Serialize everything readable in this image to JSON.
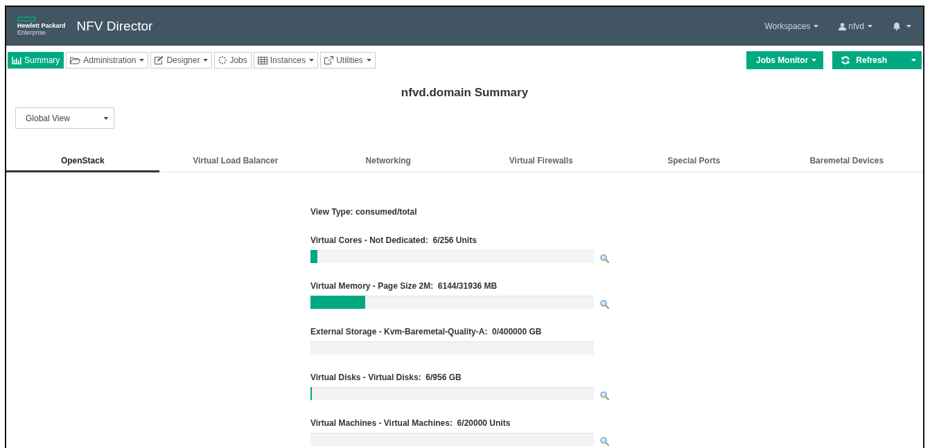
{
  "header": {
    "brand": [
      "Hewlett Packard",
      "Enterprise"
    ],
    "title": "NFV Director",
    "menus": [
      {
        "kind": "text",
        "label": "Workspaces"
      },
      {
        "kind": "user",
        "label": "nfvd"
      },
      {
        "kind": "bell"
      }
    ]
  },
  "toolbar": [
    {
      "label": "Summary",
      "selected": true,
      "dropdown": false
    },
    {
      "label": "Administration",
      "selected": false,
      "dropdown": true
    },
    {
      "label": "Designer",
      "selected": false,
      "dropdown": true
    },
    {
      "label": "Jobs",
      "selected": false,
      "dropdown": false
    },
    {
      "label": "Instances",
      "selected": false,
      "dropdown": true
    },
    {
      "label": "Utilities",
      "selected": false,
      "dropdown": true
    }
  ],
  "actions": [
    {
      "label": "Jobs Monitor",
      "kind": "menu"
    },
    {
      "label": "Refresh",
      "kind": "split"
    }
  ],
  "page_title": "nfvd.domain Summary",
  "view_select": {
    "value": "Global View"
  },
  "tabs": [
    {
      "label": "OpenStack",
      "selected": true
    },
    {
      "label": "Virtual Load Balancer",
      "selected": false
    },
    {
      "label": "Networking",
      "selected": false
    },
    {
      "label": "Virtual Firewalls",
      "selected": false
    },
    {
      "label": "Special Ports",
      "selected": false
    },
    {
      "label": "Baremetal Devices",
      "selected": false
    }
  ],
  "view_type": "View Type: consumed/total",
  "metrics": [
    {
      "label": "Virtual Cores - Not Dedicated:  6/256 Units",
      "level": 0.024,
      "detail_icon": true
    },
    {
      "label": "Virtual Memory - Page Size 2M:  6144/31936 MB",
      "level": 0.192,
      "detail_icon": true
    },
    {
      "label": "External Storage - Kvm-Baremetal-Quality-A:  0/400000 GB",
      "detail_icon": false
    },
    {
      "label": "Virtual Disks - Virtual Disks:  6/956 GB",
      "level": 0.006,
      "detail_icon": true
    },
    {
      "label": "Virtual Machines - Virtual Machines:  6/20000 Units",
      "detail_icon": true
    }
  ]
}
